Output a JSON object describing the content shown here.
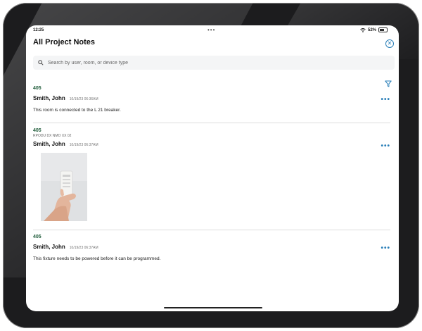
{
  "status": {
    "time": "12:25",
    "battery_pct": "52%"
  },
  "header": {
    "title": "All Project Notes"
  },
  "search": {
    "placeholder": "Search by user, room, or device type"
  },
  "notes": [
    {
      "room": "405",
      "author": "Smith, John",
      "timestamp": "10/19/23 06:36AM",
      "text": "This room is connected to the L 21 breaker."
    },
    {
      "room": "405",
      "device_type": "RPODU DX NMO XX 02",
      "author": "Smith, John",
      "timestamp": "10/19/23 06:37AM",
      "has_photo": true
    },
    {
      "room": "405",
      "author": "Smith, John",
      "timestamp": "10/19/23 06:37AM",
      "text": "This fixture needs to be powered before it can be programmed."
    }
  ],
  "icons": {
    "more": "more-horizontal-icon",
    "filter": "filter-icon",
    "close": "close-circle-icon",
    "search": "search-icon"
  },
  "colors": {
    "accent": "#2a7fb8",
    "room": "#1f5c3a"
  }
}
